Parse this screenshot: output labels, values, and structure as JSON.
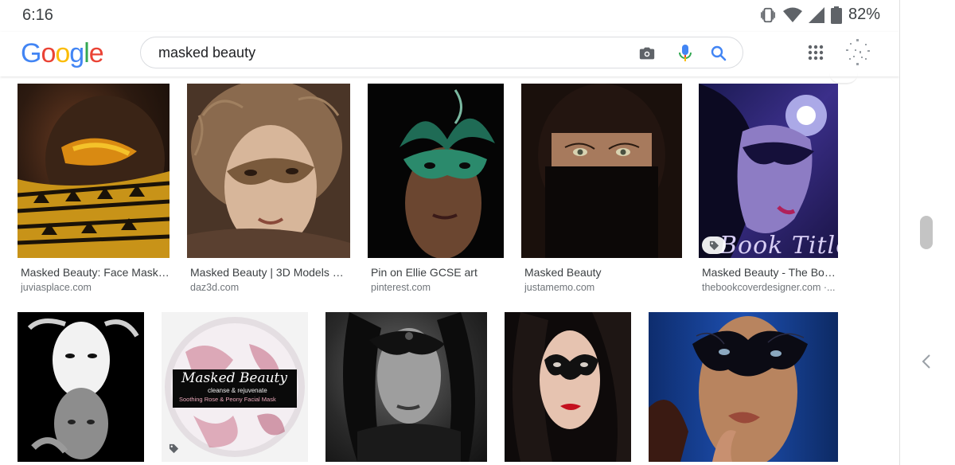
{
  "status_bar": {
    "time": "6:16",
    "battery_percent": "82%",
    "icons": [
      "vibrate-icon",
      "wifi-icon",
      "signal-icon",
      "battery-icon"
    ]
  },
  "header": {
    "logo_letters": [
      {
        "ch": "G",
        "color": "#4285F4"
      },
      {
        "ch": "o",
        "color": "#EA4335"
      },
      {
        "ch": "o",
        "color": "#FBBC05"
      },
      {
        "ch": "g",
        "color": "#4285F4"
      },
      {
        "ch": "l",
        "color": "#34A853"
      },
      {
        "ch": "e",
        "color": "#EA4335"
      }
    ],
    "search": {
      "value": "masked beauty"
    },
    "icons": [
      "camera-icon",
      "mic-icon",
      "search-icon",
      "apps-grid-icon",
      "account-icon"
    ]
  },
  "results_row1": [
    {
      "title": "Masked Beauty: Face Mask ...",
      "source": "juviasplace.com"
    },
    {
      "title": "Masked Beauty | 3D Models an...",
      "source": "daz3d.com"
    },
    {
      "title": "Pin on Ellie GCSE art",
      "source": "pinterest.com"
    },
    {
      "title": "Masked Beauty",
      "source": "justamemo.com"
    },
    {
      "title": "Masked Beauty - The Boo...",
      "source": "thebookcoverdesigner.com ·..."
    }
  ],
  "book_cover_text": "Book Title",
  "product_label": {
    "brand": "Masked Beauty",
    "sub": "cleanse & rejuvenate",
    "name": "Soothing Rose & Peony Facial Mask"
  },
  "colors": {
    "text_primary": "#3c4043",
    "text_secondary": "#70757a",
    "search_border": "#dadce0"
  }
}
